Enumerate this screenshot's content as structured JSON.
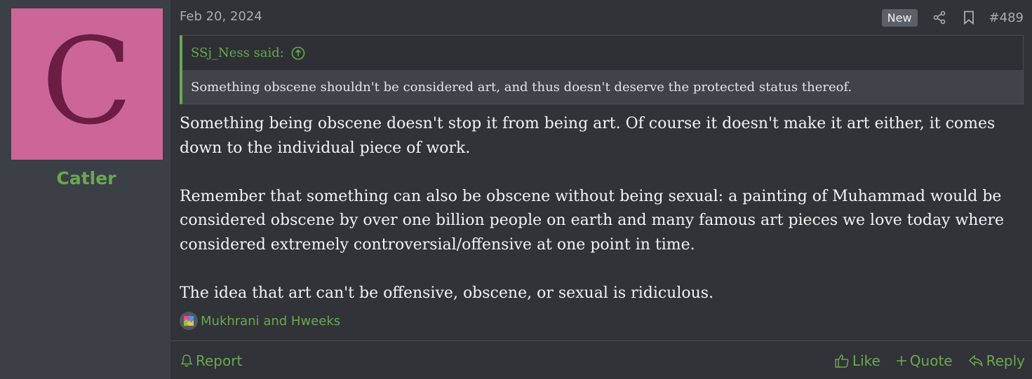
{
  "user": {
    "avatar_letter": "C",
    "avatar_bg": "#cc6699",
    "username": "Catler"
  },
  "post": {
    "date": "Feb 20, 2024",
    "new_badge": "New",
    "number": "#489"
  },
  "quote": {
    "author": "SSj_Ness said:",
    "text": "Something obscene shouldn't be considered art, and thus doesn't deserve the protected status thereof."
  },
  "message": {
    "paragraphs": [
      "Something being obscene doesn't stop it from being art. Of course it doesn't make it art either, it comes down to the individual piece of work.",
      "Remember that something can also be obscene without being sexual: a painting of Muhammad would be considered obscene by over one billion people on earth and many famous art pieces we love today where considered extremely controversial/offensive at one point in time.",
      "The idea that art can't be offensive, obscene, or sexual is ridiculous."
    ]
  },
  "reactions": {
    "users": "Mukhrani and Hweeks"
  },
  "footer": {
    "report": "Report",
    "like": "Like",
    "quote": "Quote",
    "reply": "Reply"
  },
  "colors": {
    "accent": "#6aa84f",
    "background": "#313338",
    "sidebar": "#3b3f46"
  }
}
